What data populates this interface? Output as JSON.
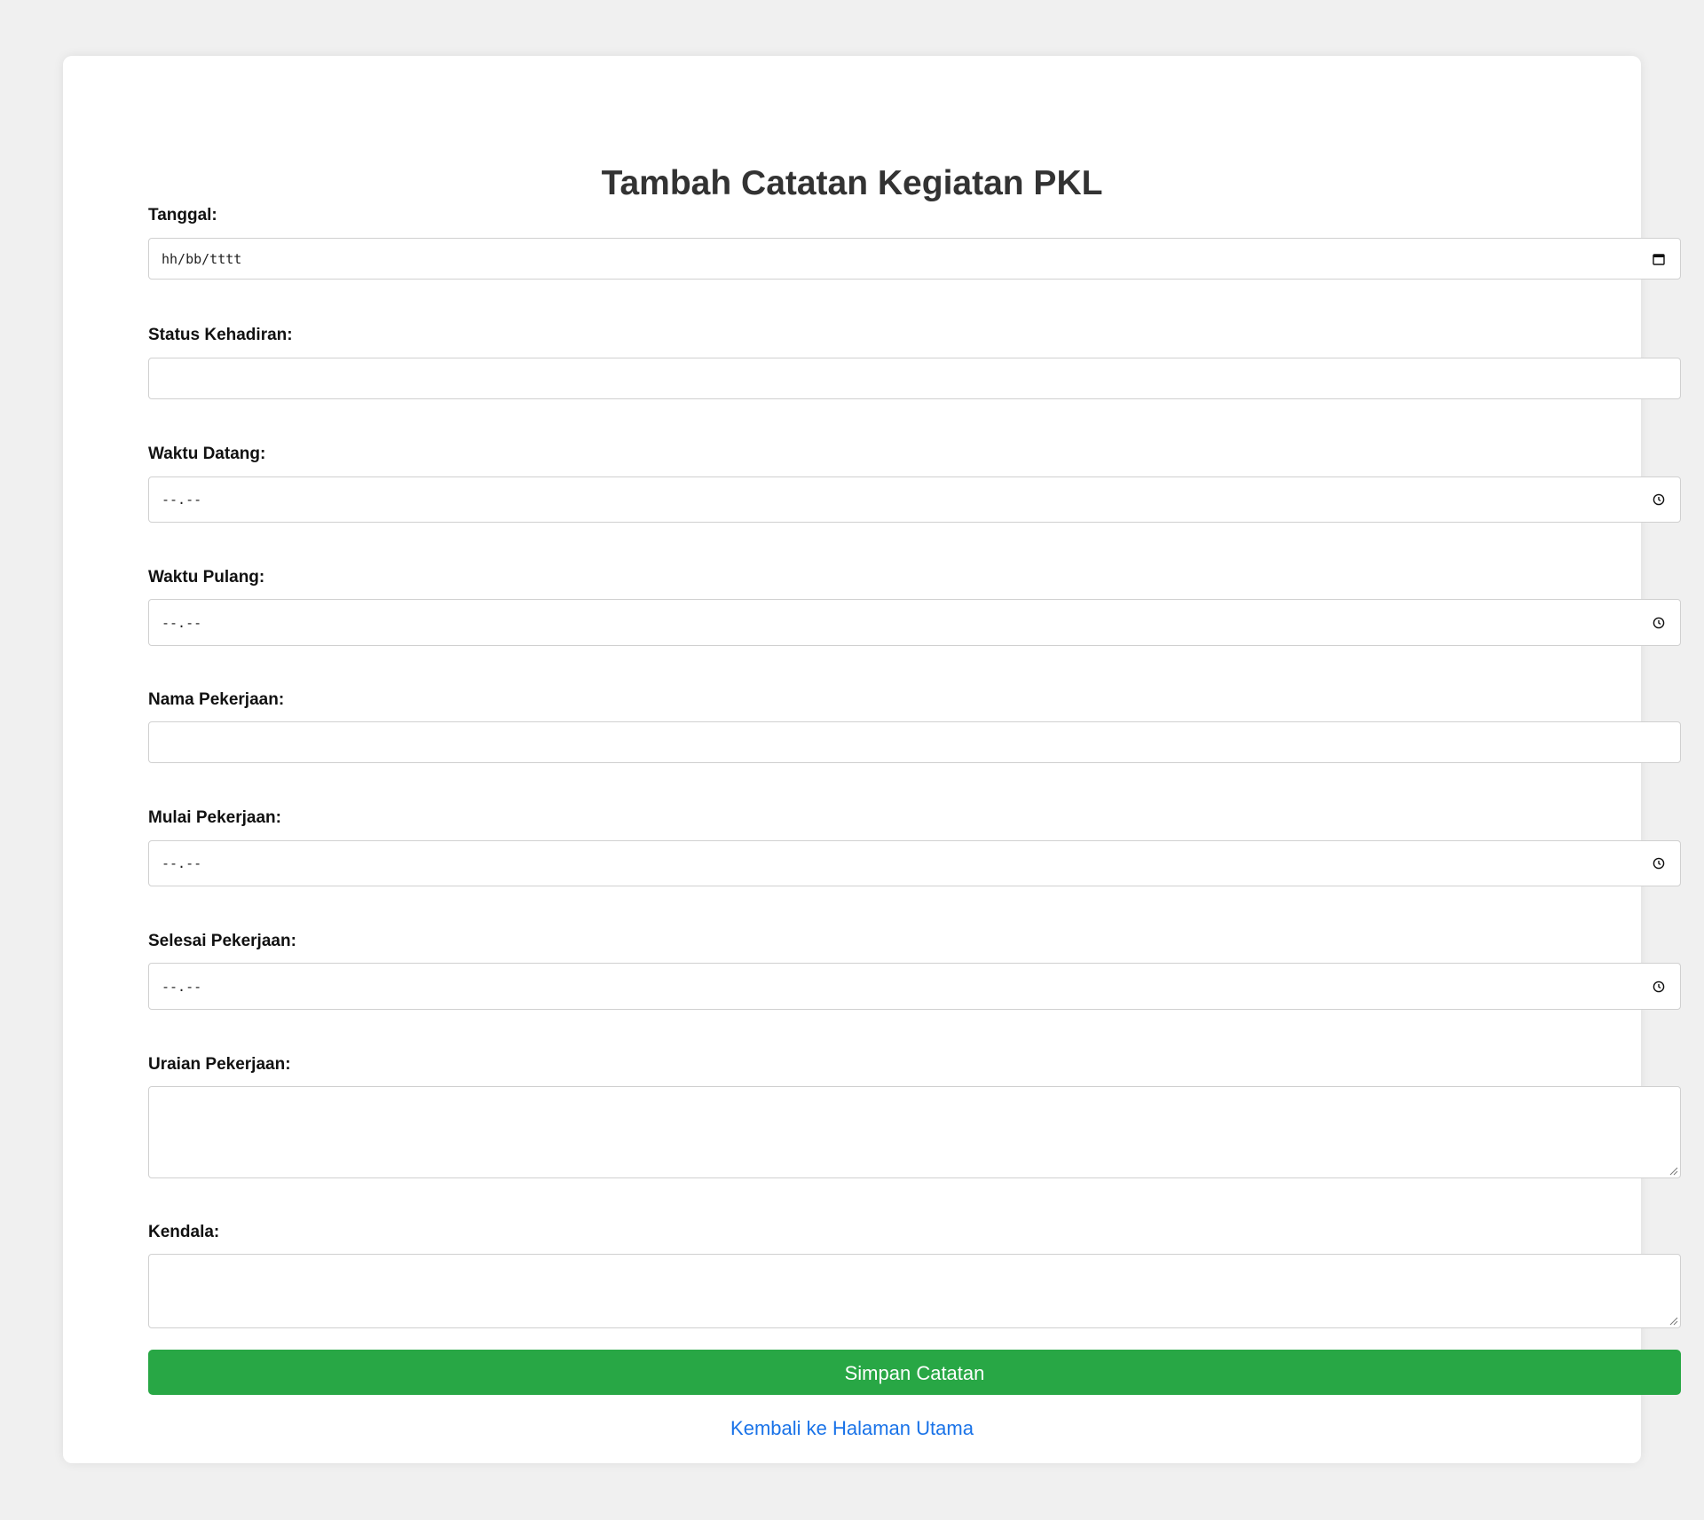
{
  "form": {
    "title": "Tambah Catatan Kegiatan PKL",
    "fields": {
      "tanggal": {
        "label": "Tanggal:",
        "placeholder": "hh/bb/tttt",
        "icon": "calendar-icon"
      },
      "status_kehadiran": {
        "label": "Status Kehadiran:",
        "value": ""
      },
      "waktu_datang": {
        "label": "Waktu Datang:",
        "placeholder": "--.--",
        "icon": "clock-icon"
      },
      "waktu_pulang": {
        "label": "Waktu Pulang:",
        "placeholder": "--.--",
        "icon": "clock-icon"
      },
      "nama_pekerjaan": {
        "label": "Nama Pekerjaan:",
        "value": ""
      },
      "mulai_pekerjaan": {
        "label": "Mulai Pekerjaan:",
        "placeholder": "--.--",
        "icon": "clock-icon"
      },
      "selesai_pekerjaan": {
        "label": "Selesai Pekerjaan:",
        "placeholder": "--.--",
        "icon": "clock-icon"
      },
      "uraian_pekerjaan": {
        "label": "Uraian Pekerjaan:",
        "value": ""
      },
      "kendala": {
        "label": "Kendala:",
        "value": ""
      }
    },
    "submit_label": "Simpan Catatan",
    "back_link": "Kembali ke Halaman Utama"
  },
  "colors": {
    "page_background": "#f0f0f0",
    "card_background": "#ffffff",
    "submit_button": "#28a745",
    "link": "#1a73e8",
    "title": "#333333"
  }
}
